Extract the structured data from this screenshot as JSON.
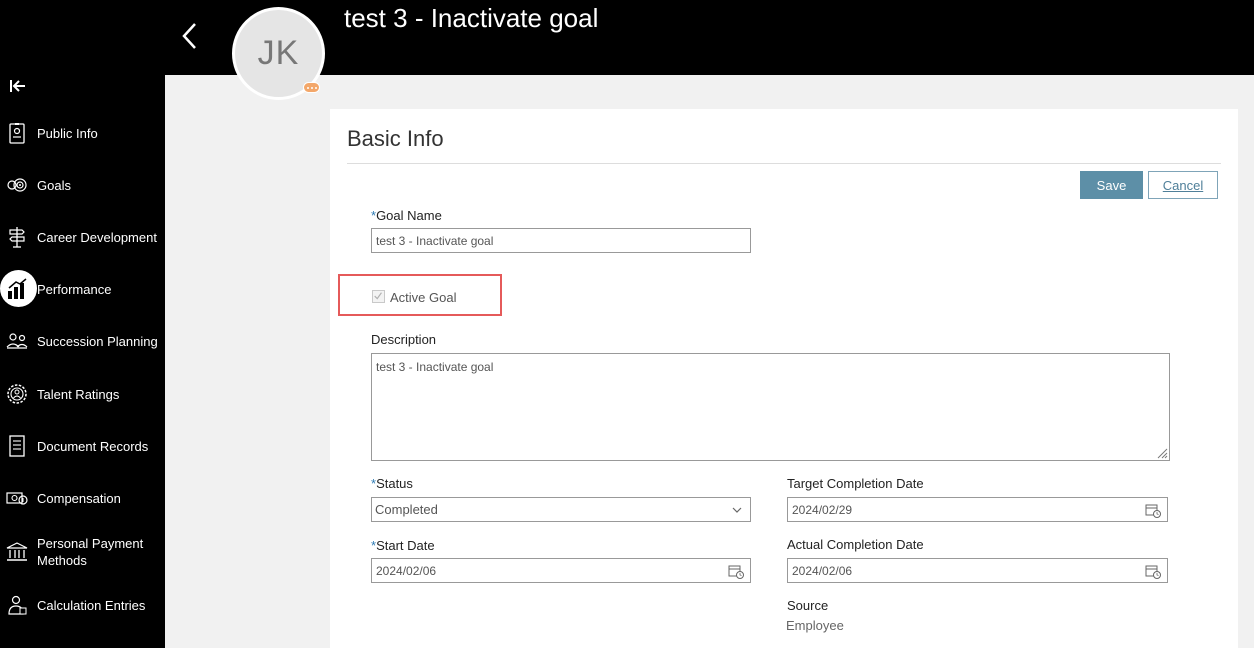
{
  "header": {
    "title": "test 3 - Inactivate goal",
    "avatar_initials": "JK"
  },
  "sidebar": {
    "items": [
      {
        "label": "Public Info",
        "icon": "id-badge-icon"
      },
      {
        "label": "Goals",
        "icon": "target-icon"
      },
      {
        "label": "Career Development",
        "icon": "signpost-icon"
      },
      {
        "label": "Performance",
        "icon": "bar-chart-icon",
        "selected": true
      },
      {
        "label": "Succession Planning",
        "icon": "people-icon"
      },
      {
        "label": "Talent Ratings",
        "icon": "gear-person-icon"
      },
      {
        "label": "Document Records",
        "icon": "document-icon"
      },
      {
        "label": "Compensation",
        "icon": "money-icon"
      },
      {
        "label": "Personal Payment Methods",
        "icon": "bank-icon"
      },
      {
        "label": "Calculation Entries",
        "icon": "person-calc-icon"
      }
    ]
  },
  "form": {
    "section_title": "Basic Info",
    "save_label": "Save",
    "cancel_label": "Cancel",
    "goal_name_label": "Goal Name",
    "goal_name_value": "test 3 - Inactivate goal",
    "active_goal_label": "Active Goal",
    "active_goal_checked": true,
    "description_label": "Description",
    "description_value": "test 3 - Inactivate goal",
    "status_label": "Status",
    "status_value": "Completed",
    "target_completion_label": "Target Completion Date",
    "target_completion_value": "2024/02/29",
    "start_date_label": "Start Date",
    "start_date_value": "2024/02/06",
    "actual_completion_label": "Actual Completion Date",
    "actual_completion_value": "2024/02/06",
    "source_label": "Source",
    "source_value": "Employee",
    "required_mark": "*"
  },
  "colors": {
    "accent": "#5d8fa7",
    "highlight": "#e55a5a",
    "required": "#2e7bb4"
  }
}
